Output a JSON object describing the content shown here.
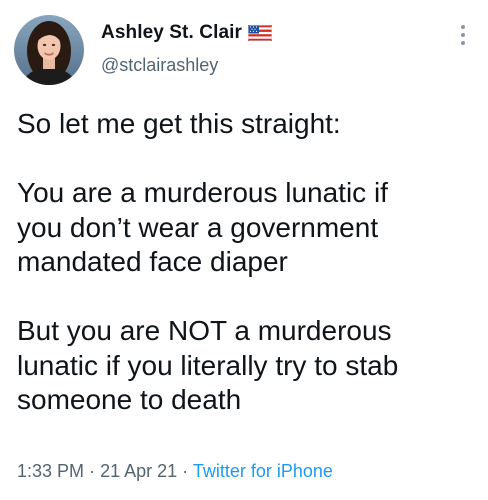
{
  "user": {
    "display_name": "Ashley St. Clair",
    "handle": "@stclairashley",
    "avatar_icon": "profile-photo",
    "badge_icon": "us-flag-icon"
  },
  "tweet": {
    "lines": [
      "So let me get this straight:",
      "",
      "You are a murderous lunatic if",
      "you don’t wear a government",
      "mandated face diaper",
      "",
      "But you are NOT a murderous",
      "lunatic if you literally try to stab",
      "someone to death"
    ]
  },
  "meta": {
    "time": "1:33 PM",
    "separator": "·",
    "date": "21 Apr 21",
    "source": "Twitter for iPhone"
  },
  "menu": {
    "icon": "more-vertical-icon"
  },
  "colors": {
    "text": "#0f1419",
    "secondary": "#536471",
    "link": "#1d9bf0"
  }
}
